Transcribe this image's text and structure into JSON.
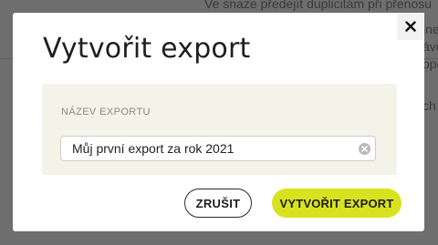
{
  "background": {
    "line1": "Ve snaze předejít duplicitám při přenosu",
    "line2": "ine",
    "line3": "ávě",
    "line4": "ope",
    "line5": "ch"
  },
  "dialog": {
    "title": "Vytvořit export",
    "close_icon": "close-icon",
    "field": {
      "label": "NÁZEV EXPORTU",
      "value": "Můj první export za rok 2021"
    },
    "cancel_label": "ZRUŠIT",
    "create_label": "VYTVOŘIT EXPORT"
  },
  "colors": {
    "accent": "#d9e21f",
    "overlay": "#6e6e6e",
    "panel": "#f3f3ea"
  }
}
